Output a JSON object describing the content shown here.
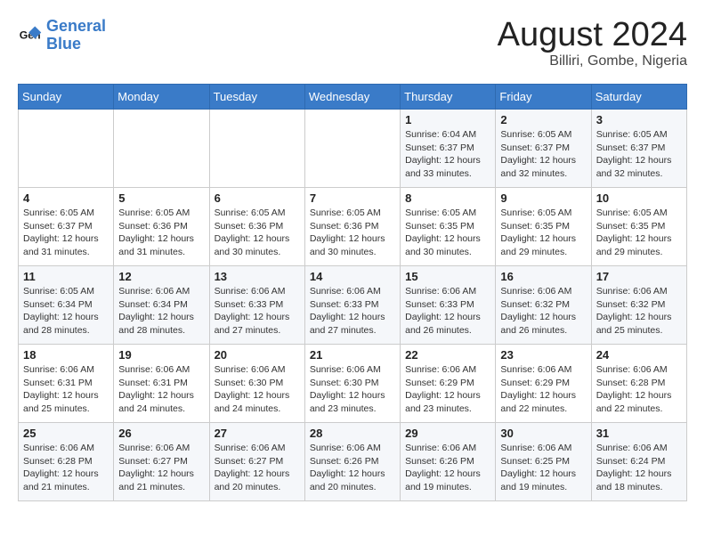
{
  "logo": {
    "line1": "General",
    "line2": "Blue"
  },
  "title": "August 2024",
  "location": "Billiri, Gombe, Nigeria",
  "days_of_week": [
    "Sunday",
    "Monday",
    "Tuesday",
    "Wednesday",
    "Thursday",
    "Friday",
    "Saturday"
  ],
  "weeks": [
    [
      {
        "num": "",
        "detail": ""
      },
      {
        "num": "",
        "detail": ""
      },
      {
        "num": "",
        "detail": ""
      },
      {
        "num": "",
        "detail": ""
      },
      {
        "num": "1",
        "detail": "Sunrise: 6:04 AM\nSunset: 6:37 PM\nDaylight: 12 hours\nand 33 minutes."
      },
      {
        "num": "2",
        "detail": "Sunrise: 6:05 AM\nSunset: 6:37 PM\nDaylight: 12 hours\nand 32 minutes."
      },
      {
        "num": "3",
        "detail": "Sunrise: 6:05 AM\nSunset: 6:37 PM\nDaylight: 12 hours\nand 32 minutes."
      }
    ],
    [
      {
        "num": "4",
        "detail": "Sunrise: 6:05 AM\nSunset: 6:37 PM\nDaylight: 12 hours\nand 31 minutes."
      },
      {
        "num": "5",
        "detail": "Sunrise: 6:05 AM\nSunset: 6:36 PM\nDaylight: 12 hours\nand 31 minutes."
      },
      {
        "num": "6",
        "detail": "Sunrise: 6:05 AM\nSunset: 6:36 PM\nDaylight: 12 hours\nand 30 minutes."
      },
      {
        "num": "7",
        "detail": "Sunrise: 6:05 AM\nSunset: 6:36 PM\nDaylight: 12 hours\nand 30 minutes."
      },
      {
        "num": "8",
        "detail": "Sunrise: 6:05 AM\nSunset: 6:35 PM\nDaylight: 12 hours\nand 30 minutes."
      },
      {
        "num": "9",
        "detail": "Sunrise: 6:05 AM\nSunset: 6:35 PM\nDaylight: 12 hours\nand 29 minutes."
      },
      {
        "num": "10",
        "detail": "Sunrise: 6:05 AM\nSunset: 6:35 PM\nDaylight: 12 hours\nand 29 minutes."
      }
    ],
    [
      {
        "num": "11",
        "detail": "Sunrise: 6:05 AM\nSunset: 6:34 PM\nDaylight: 12 hours\nand 28 minutes."
      },
      {
        "num": "12",
        "detail": "Sunrise: 6:06 AM\nSunset: 6:34 PM\nDaylight: 12 hours\nand 28 minutes."
      },
      {
        "num": "13",
        "detail": "Sunrise: 6:06 AM\nSunset: 6:33 PM\nDaylight: 12 hours\nand 27 minutes."
      },
      {
        "num": "14",
        "detail": "Sunrise: 6:06 AM\nSunset: 6:33 PM\nDaylight: 12 hours\nand 27 minutes."
      },
      {
        "num": "15",
        "detail": "Sunrise: 6:06 AM\nSunset: 6:33 PM\nDaylight: 12 hours\nand 26 minutes."
      },
      {
        "num": "16",
        "detail": "Sunrise: 6:06 AM\nSunset: 6:32 PM\nDaylight: 12 hours\nand 26 minutes."
      },
      {
        "num": "17",
        "detail": "Sunrise: 6:06 AM\nSunset: 6:32 PM\nDaylight: 12 hours\nand 25 minutes."
      }
    ],
    [
      {
        "num": "18",
        "detail": "Sunrise: 6:06 AM\nSunset: 6:31 PM\nDaylight: 12 hours\nand 25 minutes."
      },
      {
        "num": "19",
        "detail": "Sunrise: 6:06 AM\nSunset: 6:31 PM\nDaylight: 12 hours\nand 24 minutes."
      },
      {
        "num": "20",
        "detail": "Sunrise: 6:06 AM\nSunset: 6:30 PM\nDaylight: 12 hours\nand 24 minutes."
      },
      {
        "num": "21",
        "detail": "Sunrise: 6:06 AM\nSunset: 6:30 PM\nDaylight: 12 hours\nand 23 minutes."
      },
      {
        "num": "22",
        "detail": "Sunrise: 6:06 AM\nSunset: 6:29 PM\nDaylight: 12 hours\nand 23 minutes."
      },
      {
        "num": "23",
        "detail": "Sunrise: 6:06 AM\nSunset: 6:29 PM\nDaylight: 12 hours\nand 22 minutes."
      },
      {
        "num": "24",
        "detail": "Sunrise: 6:06 AM\nSunset: 6:28 PM\nDaylight: 12 hours\nand 22 minutes."
      }
    ],
    [
      {
        "num": "25",
        "detail": "Sunrise: 6:06 AM\nSunset: 6:28 PM\nDaylight: 12 hours\nand 21 minutes."
      },
      {
        "num": "26",
        "detail": "Sunrise: 6:06 AM\nSunset: 6:27 PM\nDaylight: 12 hours\nand 21 minutes."
      },
      {
        "num": "27",
        "detail": "Sunrise: 6:06 AM\nSunset: 6:27 PM\nDaylight: 12 hours\nand 20 minutes."
      },
      {
        "num": "28",
        "detail": "Sunrise: 6:06 AM\nSunset: 6:26 PM\nDaylight: 12 hours\nand 20 minutes."
      },
      {
        "num": "29",
        "detail": "Sunrise: 6:06 AM\nSunset: 6:26 PM\nDaylight: 12 hours\nand 19 minutes."
      },
      {
        "num": "30",
        "detail": "Sunrise: 6:06 AM\nSunset: 6:25 PM\nDaylight: 12 hours\nand 19 minutes."
      },
      {
        "num": "31",
        "detail": "Sunrise: 6:06 AM\nSunset: 6:24 PM\nDaylight: 12 hours\nand 18 minutes."
      }
    ]
  ]
}
